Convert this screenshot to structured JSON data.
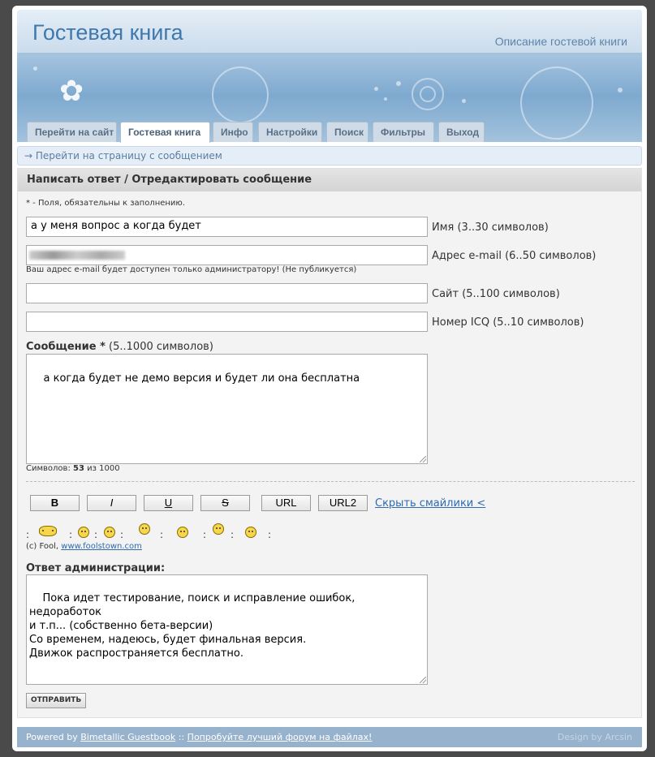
{
  "header": {
    "title": "Гостевая книга",
    "description": "Описание гостевой книги"
  },
  "tabs": [
    {
      "label": "Перейти на сайт"
    },
    {
      "label": "Гостевая книга",
      "active": true
    },
    {
      "label": "Инфо"
    },
    {
      "label": "Настройки"
    },
    {
      "label": "Поиск"
    },
    {
      "label": "Фильтры"
    },
    {
      "label": "Выход"
    }
  ],
  "breadcrumb": {
    "arrow": "→",
    "text": "Перейти на страницу с сообщением"
  },
  "form": {
    "heading": "Написать ответ / Отредактировать сообщение",
    "required_note": "* - Поля, обязательны к заполнению.",
    "name_value": "а у меня вопрос а когда будет",
    "name_label": "Имя (3..30 символов)",
    "email_value": "",
    "email_label": "Адрес e-mail (6..50 символов)",
    "email_note": "Ваш адрес e-mail будет доступен только администратору! (Не публикуется)",
    "site_value": "",
    "site_label": "Сайт (5..100 символов)",
    "icq_value": "",
    "icq_label": "Номер ICQ (5..10 символов)",
    "message_label": "Сообщение *",
    "message_hint": "(5..1000 символов)",
    "message_value": "а когда будет не демо версия и будет ли она бесплатна",
    "counter_prefix": "Символов:",
    "counter_count": "53",
    "counter_suffix": "из 1000",
    "buttons": {
      "bold": "B",
      "italic": "I",
      "underline": "U",
      "strike": "S",
      "url": "URL",
      "url2": "URL2"
    },
    "hide_smileys": "Скрыть смайлики <",
    "smileys": [
      "teeth-grin-icon",
      "wink-icon",
      "surprised-icon",
      "cry-icon",
      "big-eyes-icon",
      "crazy-icon",
      "bug-eyes-icon"
    ],
    "smiley_credit_prefix": "(c) Fool,",
    "smiley_credit_link": "www.foolstown.com",
    "admin_label": "Ответ администрации:",
    "admin_value": "Пока идет тестирование, поиск и исправление ошибок, недоработок\nи т.п... (собственно бета-версии)\nСо временем, надеюсь, будет финальная версия.\nДвижок распространяется бесплатно.",
    "submit": "ОТПРАВИТЬ"
  },
  "footer": {
    "powered": "Powered by",
    "product_link": "Bimetallic Guestbook",
    "sep": "::",
    "forum_link": "Попробуйте лучший форум на файлах!",
    "design": "Design by Arcsin"
  }
}
